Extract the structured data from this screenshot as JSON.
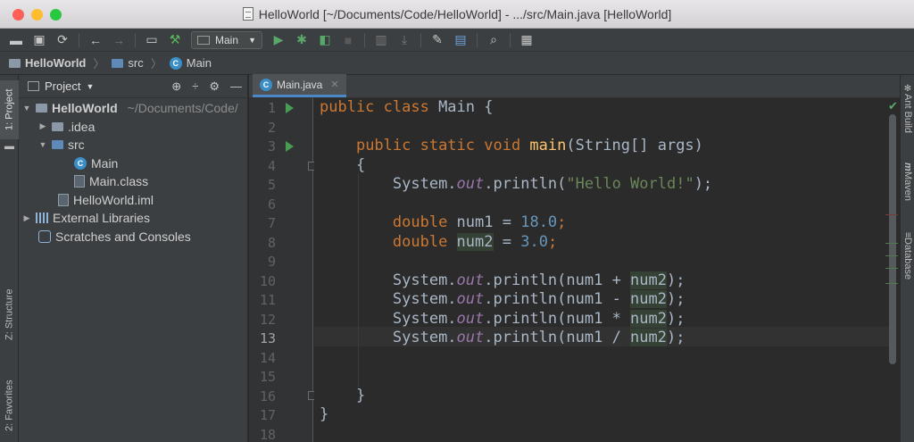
{
  "window": {
    "title": "HelloWorld [~/Documents/Code/HelloWorld] - .../src/Main.java [HelloWorld]",
    "traffic_colors": [
      "#fe5f57",
      "#febc2e",
      "#28c840"
    ]
  },
  "toolbar": {
    "run_config": "Main",
    "icons": [
      "open-icon",
      "save-icon",
      "sync-icon",
      "back-icon",
      "forward-icon",
      "frame-icon",
      "build-icon",
      "run-icon",
      "debug-icon",
      "coverage-icon",
      "stop-icon",
      "build-artifact-icon",
      "deploy-icon",
      "settings-icon",
      "project-structure-icon",
      "search-icon",
      "terminal-icon"
    ]
  },
  "breadcrumb": {
    "project": "HelloWorld",
    "folder": "src",
    "file": "Main"
  },
  "left_stripe": {
    "project_tab": "1: Project",
    "structure_tab": "Z: Structure",
    "favorites_tab": "2: Favorites"
  },
  "project_panel": {
    "title": "Project",
    "tree": {
      "root_name": "HelloWorld",
      "root_path": "~/Documents/Code/",
      "idea": ".idea",
      "src": "src",
      "main": "Main",
      "main_class": "Main.class",
      "iml": "HelloWorld.iml",
      "external_libraries": "External Libraries",
      "scratches": "Scratches and Consoles"
    }
  },
  "editor": {
    "tab_label": "Main.java",
    "current_line": 13,
    "line_numbers": [
      "1",
      "2",
      "3",
      "4",
      "5",
      "6",
      "7",
      "8",
      "9",
      "10",
      "11",
      "12",
      "13",
      "14",
      "15",
      "16",
      "17",
      "18"
    ],
    "code": {
      "l1_kw": "public class ",
      "l1_rest": "Main {",
      "l3_kw": "public static void ",
      "l3_fn": "main",
      "l3_rest": "(String[] args)",
      "l4": "{",
      "l5_a": "System.",
      "l5_fld": "out",
      "l5_b": ".println(",
      "l5_str": "\"Hello World!\"",
      "l5_c": ");",
      "l7_kw": "double ",
      "l7_var": "num1",
      "l7_eq": " = ",
      "l7_num": "18.0",
      "l7_end": ";",
      "l8_kw": "double ",
      "l8_var": "num2",
      "l8_eq": " = ",
      "l8_num": "3.0",
      "l8_end": ";",
      "l10_op": "num1 + ",
      "l11_op": "num1 - ",
      "l12_op": "num1 * ",
      "l13_op": "num1 / ",
      "num2": "num2",
      "close_paren": ");",
      "l16": "}",
      "l17": "}"
    },
    "colors": {
      "keyword": "#cc7832",
      "number": "#6897bb",
      "string": "#6a8759",
      "function": "#ffc66d",
      "field": "#9876aa"
    }
  },
  "right_stripe": {
    "ant": "Ant Build",
    "maven": "Maven",
    "database": "Database"
  }
}
